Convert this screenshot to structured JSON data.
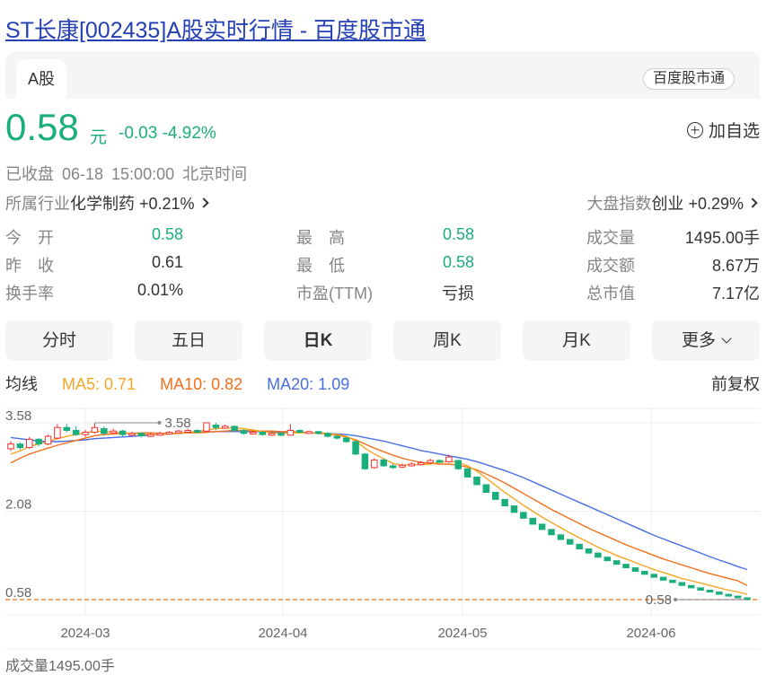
{
  "page": {
    "title": "ST长康[002435]A股实时行情 - 百度股市通"
  },
  "tabs": {
    "market_tab": "A股",
    "brand_badge": "百度股市通"
  },
  "quote": {
    "price": "0.58",
    "unit": "元",
    "change": "-0.03  -4.92%",
    "watch_label": "加自选",
    "status": "已收盘  06-18 15:00:00  北京时间",
    "industry_label": "所属行业",
    "industry_value": "化学制药 +0.21%",
    "index_label": "大盘指数",
    "index_value": "创业 +0.29%"
  },
  "stats": [
    {
      "label": "今　开",
      "value": "0.58"
    },
    {
      "label": "昨　收",
      "value": "0.61"
    },
    {
      "label": "换手率",
      "value": "0.01%"
    },
    {
      "label": "最　高",
      "value": "0.58"
    },
    {
      "label": "最　低",
      "value": "0.58"
    },
    {
      "label": "市盈(TTM)",
      "value": "亏损"
    },
    {
      "label": "成交量",
      "value": "1495.00手"
    },
    {
      "label": "成交额",
      "value": "8.67万"
    },
    {
      "label": "总市值",
      "value": "7.17亿"
    }
  ],
  "period_tabs": [
    "分时",
    "五日",
    "日K",
    "周K",
    "月K",
    "更多"
  ],
  "active_period": "日K",
  "ma": {
    "label": "均线",
    "ma5": "MA5: 0.71",
    "ma10": "MA10: 0.82",
    "ma20": "MA20: 1.09",
    "restore": "前复权"
  },
  "colors": {
    "up": "#f23030",
    "down": "#1bae7d",
    "ma5": "#f5a623",
    "ma10": "#f2701a",
    "ma20": "#4a6fe3",
    "title_link": "#2440b3"
  },
  "volume_label": "成交量1495.00手",
  "chart_data": {
    "type": "candlestick",
    "y_ticks": [
      "3.58",
      "2.08",
      "0.58"
    ],
    "x_ticks": [
      "2024-03",
      "2024-04",
      "2024-05",
      "2024-06"
    ],
    "ylim": [
      0.58,
      3.58
    ],
    "max_marker": "3.58",
    "last_marker": "0.58",
    "candles": [
      [
        3.14,
        3.22,
        3.27,
        3.1
      ],
      [
        3.22,
        3.16,
        3.25,
        3.12
      ],
      [
        3.16,
        3.3,
        3.34,
        3.14
      ],
      [
        3.3,
        3.22,
        3.32,
        3.18
      ],
      [
        3.22,
        3.35,
        3.38,
        3.2
      ],
      [
        3.32,
        3.5,
        3.56,
        3.3
      ],
      [
        3.5,
        3.45,
        3.56,
        3.42
      ],
      [
        3.45,
        3.38,
        3.52,
        3.36
      ],
      [
        3.38,
        3.42,
        3.46,
        3.34
      ],
      [
        3.42,
        3.5,
        3.58,
        3.4
      ],
      [
        3.48,
        3.4,
        3.52,
        3.36
      ],
      [
        3.42,
        3.44,
        3.48,
        3.4
      ],
      [
        3.44,
        3.38,
        3.46,
        3.35
      ],
      [
        3.38,
        3.4,
        3.43,
        3.36
      ],
      [
        3.4,
        3.36,
        3.42,
        3.33
      ],
      [
        3.36,
        3.38,
        3.4,
        3.34
      ],
      [
        3.38,
        3.4,
        3.43,
        3.36
      ],
      [
        3.4,
        3.42,
        3.44,
        3.39
      ],
      [
        3.42,
        3.44,
        3.46,
        3.4
      ],
      [
        3.44,
        3.45,
        3.48,
        3.42
      ],
      [
        3.45,
        3.44,
        3.47,
        3.42
      ],
      [
        3.44,
        3.58,
        3.58,
        3.42
      ],
      [
        3.54,
        3.5,
        3.58,
        3.46
      ],
      [
        3.5,
        3.52,
        3.55,
        3.48
      ],
      [
        3.52,
        3.45,
        3.54,
        3.42
      ],
      [
        3.45,
        3.4,
        3.47,
        3.38
      ],
      [
        3.4,
        3.42,
        3.44,
        3.38
      ],
      [
        3.42,
        3.38,
        3.44,
        3.36
      ],
      [
        3.38,
        3.4,
        3.42,
        3.36
      ],
      [
        3.4,
        3.37,
        3.42,
        3.35
      ],
      [
        3.37,
        3.45,
        3.56,
        3.36
      ],
      [
        3.45,
        3.42,
        3.47,
        3.4
      ],
      [
        3.42,
        3.43,
        3.45,
        3.41
      ],
      [
        3.43,
        3.4,
        3.44,
        3.38
      ],
      [
        3.4,
        3.35,
        3.42,
        3.33
      ],
      [
        3.35,
        3.32,
        3.37,
        3.3
      ],
      [
        3.32,
        3.26,
        3.34,
        3.24
      ],
      [
        3.26,
        3.05,
        3.28,
        3.03
      ],
      [
        3.05,
        2.8,
        3.07,
        2.78
      ],
      [
        2.82,
        2.95,
        2.98,
        2.8
      ],
      [
        2.95,
        2.85,
        2.97,
        2.83
      ],
      [
        2.85,
        2.83,
        2.88,
        2.8
      ],
      [
        2.83,
        2.86,
        2.89,
        2.81
      ],
      [
        2.86,
        2.88,
        2.91,
        2.84
      ],
      [
        2.88,
        2.9,
        2.93,
        2.86
      ],
      [
        2.9,
        2.94,
        2.97,
        2.88
      ],
      [
        2.94,
        2.92,
        2.96,
        2.9
      ],
      [
        2.92,
        3.0,
        3.04,
        2.9
      ],
      [
        2.94,
        2.8,
        2.96,
        2.78
      ],
      [
        2.8,
        2.66,
        2.8,
        2.66
      ],
      [
        2.66,
        2.53,
        2.66,
        2.53
      ],
      [
        2.53,
        2.4,
        2.53,
        2.4
      ],
      [
        2.4,
        2.28,
        2.4,
        2.28
      ],
      [
        2.28,
        2.17,
        2.28,
        2.17
      ],
      [
        2.17,
        2.06,
        2.17,
        2.06
      ],
      [
        2.06,
        1.96,
        2.06,
        1.96
      ],
      [
        1.96,
        1.86,
        1.96,
        1.86
      ],
      [
        1.86,
        1.77,
        1.86,
        1.77
      ],
      [
        1.77,
        1.68,
        1.77,
        1.68
      ],
      [
        1.68,
        1.6,
        1.68,
        1.6
      ],
      [
        1.6,
        1.52,
        1.6,
        1.52
      ],
      [
        1.52,
        1.44,
        1.52,
        1.44
      ],
      [
        1.44,
        1.37,
        1.44,
        1.37
      ],
      [
        1.37,
        1.3,
        1.37,
        1.3
      ],
      [
        1.3,
        1.24,
        1.3,
        1.24
      ],
      [
        1.24,
        1.18,
        1.24,
        1.18
      ],
      [
        1.18,
        1.12,
        1.18,
        1.12
      ],
      [
        1.12,
        1.06,
        1.12,
        1.06
      ],
      [
        1.06,
        1.01,
        1.06,
        1.01
      ],
      [
        1.01,
        0.96,
        1.01,
        0.96
      ],
      [
        0.96,
        0.91,
        0.96,
        0.91
      ],
      [
        0.91,
        0.87,
        0.91,
        0.87
      ],
      [
        0.87,
        0.82,
        0.87,
        0.82
      ],
      [
        0.82,
        0.78,
        0.82,
        0.78
      ],
      [
        0.78,
        0.74,
        0.78,
        0.74
      ],
      [
        0.74,
        0.71,
        0.74,
        0.71
      ],
      [
        0.71,
        0.67,
        0.71,
        0.67
      ],
      [
        0.67,
        0.64,
        0.67,
        0.64
      ],
      [
        0.64,
        0.61,
        0.64,
        0.61
      ],
      [
        0.61,
        0.58,
        0.61,
        0.58
      ]
    ],
    "ma5": [
      3.05,
      3.1,
      3.18,
      3.22,
      3.26,
      3.31,
      3.35,
      3.38,
      3.41,
      3.44,
      3.43,
      3.42,
      3.41,
      3.4,
      3.39,
      3.38,
      3.38,
      3.39,
      3.4,
      3.42,
      3.43,
      3.46,
      3.48,
      3.49,
      3.5,
      3.48,
      3.46,
      3.43,
      3.41,
      3.4,
      3.41,
      3.41,
      3.41,
      3.41,
      3.4,
      3.38,
      3.35,
      3.27,
      3.15,
      3.05,
      2.97,
      2.89,
      2.86,
      2.87,
      2.87,
      2.88,
      2.91,
      2.93,
      2.91,
      2.85,
      2.76,
      2.64,
      2.52,
      2.4,
      2.29,
      2.18,
      2.08,
      1.98,
      1.89,
      1.8,
      1.71,
      1.63,
      1.55,
      1.47,
      1.4,
      1.33,
      1.27,
      1.21,
      1.15,
      1.09,
      1.04,
      0.99,
      0.94,
      0.9,
      0.86,
      0.82,
      0.78,
      0.74,
      0.71,
      0.67
    ],
    "ma10": [
      2.9,
      2.98,
      3.05,
      3.1,
      3.15,
      3.2,
      3.24,
      3.28,
      3.32,
      3.36,
      3.38,
      3.39,
      3.4,
      3.4,
      3.41,
      3.41,
      3.4,
      3.4,
      3.4,
      3.41,
      3.41,
      3.42,
      3.43,
      3.44,
      3.45,
      3.45,
      3.44,
      3.44,
      3.44,
      3.43,
      3.43,
      3.42,
      3.41,
      3.4,
      3.39,
      3.37,
      3.34,
      3.29,
      3.22,
      3.15,
      3.09,
      3.03,
      2.98,
      2.94,
      2.91,
      2.89,
      2.88,
      2.88,
      2.86,
      2.83,
      2.78,
      2.71,
      2.64,
      2.56,
      2.47,
      2.38,
      2.29,
      2.2,
      2.11,
      2.03,
      1.95,
      1.87,
      1.79,
      1.72,
      1.65,
      1.58,
      1.51,
      1.45,
      1.39,
      1.33,
      1.27,
      1.22,
      1.17,
      1.12,
      1.07,
      1.02,
      0.98,
      0.94,
      0.9,
      0.82
    ],
    "ma20": [
      3.33,
      3.31,
      3.29,
      3.27,
      3.26,
      3.26,
      3.27,
      3.28,
      3.29,
      3.31,
      3.32,
      3.33,
      3.34,
      3.35,
      3.36,
      3.37,
      3.38,
      3.39,
      3.4,
      3.41,
      3.42,
      3.42,
      3.43,
      3.43,
      3.43,
      3.43,
      3.43,
      3.43,
      3.43,
      3.42,
      3.42,
      3.42,
      3.41,
      3.41,
      3.4,
      3.39,
      3.38,
      3.36,
      3.33,
      3.3,
      3.27,
      3.23,
      3.19,
      3.15,
      3.11,
      3.08,
      3.05,
      3.02,
      2.99,
      2.96,
      2.92,
      2.87,
      2.82,
      2.77,
      2.71,
      2.65,
      2.58,
      2.51,
      2.44,
      2.37,
      2.3,
      2.23,
      2.16,
      2.09,
      2.02,
      1.95,
      1.88,
      1.81,
      1.74,
      1.67,
      1.61,
      1.55,
      1.49,
      1.43,
      1.37,
      1.31,
      1.25,
      1.2,
      1.14,
      1.09
    ]
  }
}
